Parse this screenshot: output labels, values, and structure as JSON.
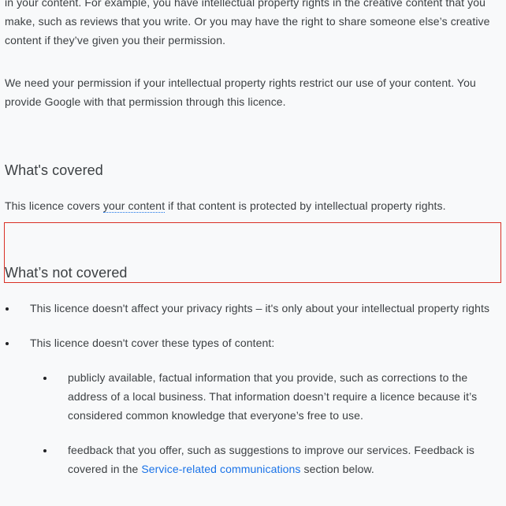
{
  "content": {
    "para_top_line1": "in your content. For example, you have intellectual property rights in the creative content that you",
    "para_top_line2": "make, such as reviews that you write. Or you may have the right to share someone else’s creative",
    "para_top_line3": "content if they’ve given you their permission.",
    "para_permission_line1": "We need your permission if your intellectual property rights restrict our use of your content. You",
    "para_permission_line2": "provide Google with that permission through this licence.",
    "heading_covered": "What's covered",
    "covered_text_before": "This licence covers ",
    "covered_link": "your content",
    "covered_text_after": " if that content is protected by intellectual property rights.",
    "heading_not_covered": "What’s not covered",
    "bullet_privacy": "This licence doesn't affect your privacy rights – it's only about your intellectual property rights",
    "bullet_content_types": "This licence doesn't cover these types of content:",
    "sub_public_line1": "publicly available, factual information that you provide, such as corrections to the",
    "sub_public_line2": "address of a local business. That information doesn’t require a licence because it’s",
    "sub_public_line3": "considered common knowledge that everyone’s free to use.",
    "sub_feedback_line1": "feedback that you offer, such as suggestions to improve our services. Feedback is",
    "sub_feedback_before_link": "covered in the ",
    "sub_feedback_link": "Service-related communications",
    "sub_feedback_after_link": " section below."
  },
  "colors": {
    "background": "#f8f9fa",
    "text": "#3c4043",
    "link": "#1a73e8",
    "highlight_border": "#d93025"
  }
}
